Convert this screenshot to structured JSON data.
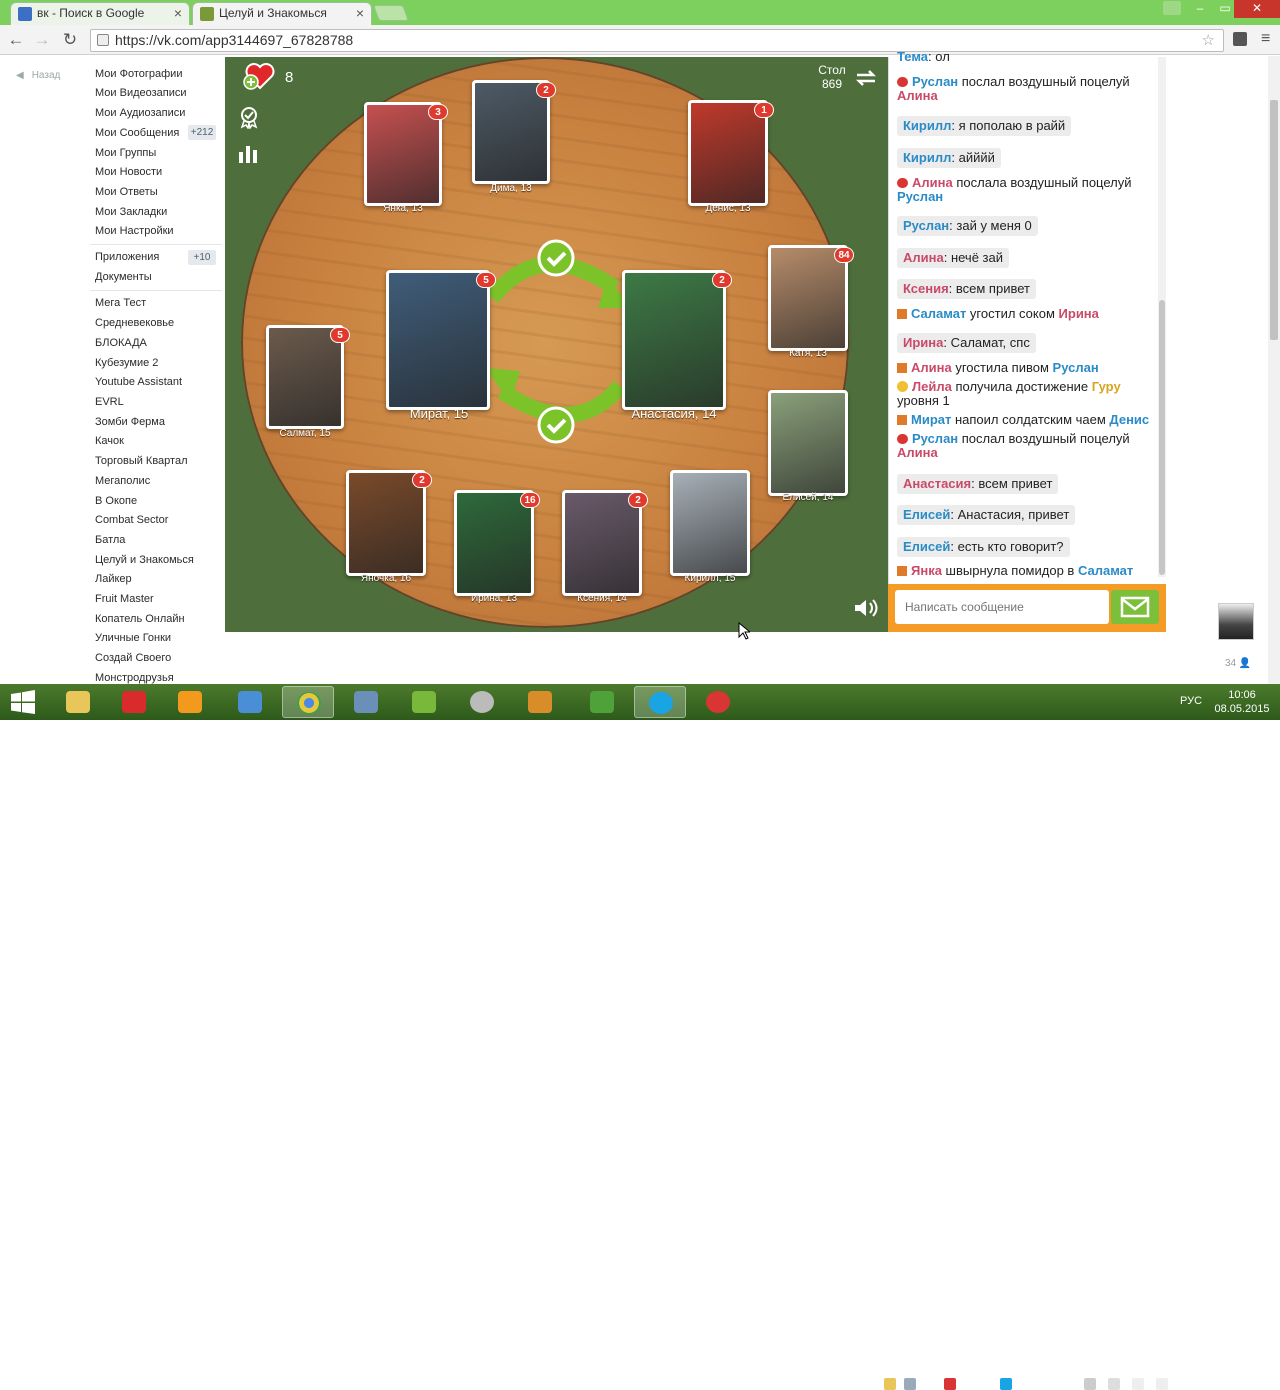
{
  "browser": {
    "tabs": [
      {
        "title": "вк - Поиск в Google",
        "close": "×"
      },
      {
        "title": "Целуй и Знакомься",
        "close": "×"
      }
    ],
    "url": "https://vk.com/app3144697_67828788",
    "window_buttons": [
      "–",
      "▭",
      "✕"
    ],
    "nav": {
      "back": "←",
      "forward": "→",
      "reload": "↻"
    }
  },
  "sidebar": {
    "back_label": "Назад",
    "items": [
      "Мои Фотографии",
      "Мои Видеозаписи",
      "Мои Аудиозаписи",
      "Мои Сообщения",
      "Мои Группы",
      "Мои Новости",
      "Мои Ответы",
      "Мои Закладки",
      "Мои Настройки",
      "Приложения",
      "Документы",
      "Мега Тест",
      "Средневековье",
      "БЛОКАДА",
      "Кубезумие 2",
      "Youtube Assistant",
      "EVRL",
      "Зомби Ферма",
      "Качок",
      "Торговый Квартал",
      "Мегаполис",
      "В Окопе",
      "Combat Sector",
      "Батла",
      "Целуй и Знакомься",
      "Лайкер",
      "Fruit Master",
      "Копатель Онлайн",
      "Уличные Гонки",
      "Создай Своего",
      "Монстродрузья"
    ],
    "badges": {
      "messages": "+212",
      "apps": "+10"
    }
  },
  "game": {
    "hearts": "8",
    "table_label": "Стол",
    "table_number": "869",
    "players": [
      {
        "name": "Янка, 13",
        "badge": "3"
      },
      {
        "name": "Дима, 13",
        "badge": "2"
      },
      {
        "name": "Денис, 13",
        "badge": "1"
      },
      {
        "name": "Катя, 13",
        "badge": "84"
      },
      {
        "name": "Салмат, 15",
        "badge": "5"
      },
      {
        "name": "Мират, 15",
        "badge": "5"
      },
      {
        "name": "Анастасия, 14",
        "badge": "2"
      },
      {
        "name": "Елисей, 14",
        "badge": ""
      },
      {
        "name": "Яночка, 16",
        "badge": "2"
      },
      {
        "name": "Ирина, 13",
        "badge": "16"
      },
      {
        "name": "Ксения, 14",
        "badge": "2"
      },
      {
        "name": "Кирилл, 15",
        "badge": ""
      }
    ]
  },
  "chat": {
    "messages": [
      {
        "type": "top",
        "name": "Тема",
        "text": ": ол"
      },
      {
        "type": "kiss",
        "name": "Руслан",
        "text": " послал воздушный поцелуй",
        "target": "Алина"
      },
      {
        "type": "say",
        "name": "Кирилл",
        "text": ": я пополаю в райй"
      },
      {
        "type": "say",
        "name": "Кирилл",
        "text": ": айййй"
      },
      {
        "type": "kiss",
        "name": "Алина",
        "text": " послала воздушный поцелуй",
        "target": "Руслан"
      },
      {
        "type": "say",
        "name": "Руслан",
        "text": ": зай у меня 0"
      },
      {
        "type": "say",
        "name": "Алина",
        "text": ": нечё зай"
      },
      {
        "type": "say",
        "name": "Ксения",
        "text": ": всем привет"
      },
      {
        "type": "gift",
        "name": "Саламат",
        "text": " угостил соком",
        "target": "Ирина"
      },
      {
        "type": "say",
        "name": "Ирина",
        "text": ": Саламат, спс"
      },
      {
        "type": "gift",
        "name": "Алина",
        "text": " угостила пивом",
        "target": "Руслан"
      },
      {
        "type": "star",
        "name": "Лейла",
        "text": " получила достижение",
        "target": "Гуру",
        "extra": "уровня 1"
      },
      {
        "type": "gift",
        "name": "Мират",
        "text": " напоил солдатским чаем",
        "target": "Денис"
      },
      {
        "type": "kiss",
        "name": "Руслан",
        "text": " послал воздушный поцелуй",
        "target": "Алина"
      },
      {
        "type": "say",
        "name": "Анастасия",
        "text": ": всем привет"
      },
      {
        "type": "say",
        "name": "Елисей",
        "text": ": Анастасия, привет"
      },
      {
        "type": "say",
        "name": "Елисей",
        "text": ": есть кто говорит?"
      },
      {
        "type": "gift",
        "name": "Янка",
        "text": " швырнула помидор в",
        "target": "Саламат"
      }
    ],
    "input_placeholder": "Написать сообщение"
  },
  "right_panel": {
    "count": "34"
  },
  "taskbar": {
    "lang": "РУС",
    "time": "10:06",
    "date": "08.05.2015"
  },
  "colors": {
    "tabbar": "#7ed05e",
    "accent_orange": "#f49c25",
    "send_green": "#7bbf3a",
    "name_blue": "#2a8bc7",
    "name_red": "#c94a68"
  }
}
